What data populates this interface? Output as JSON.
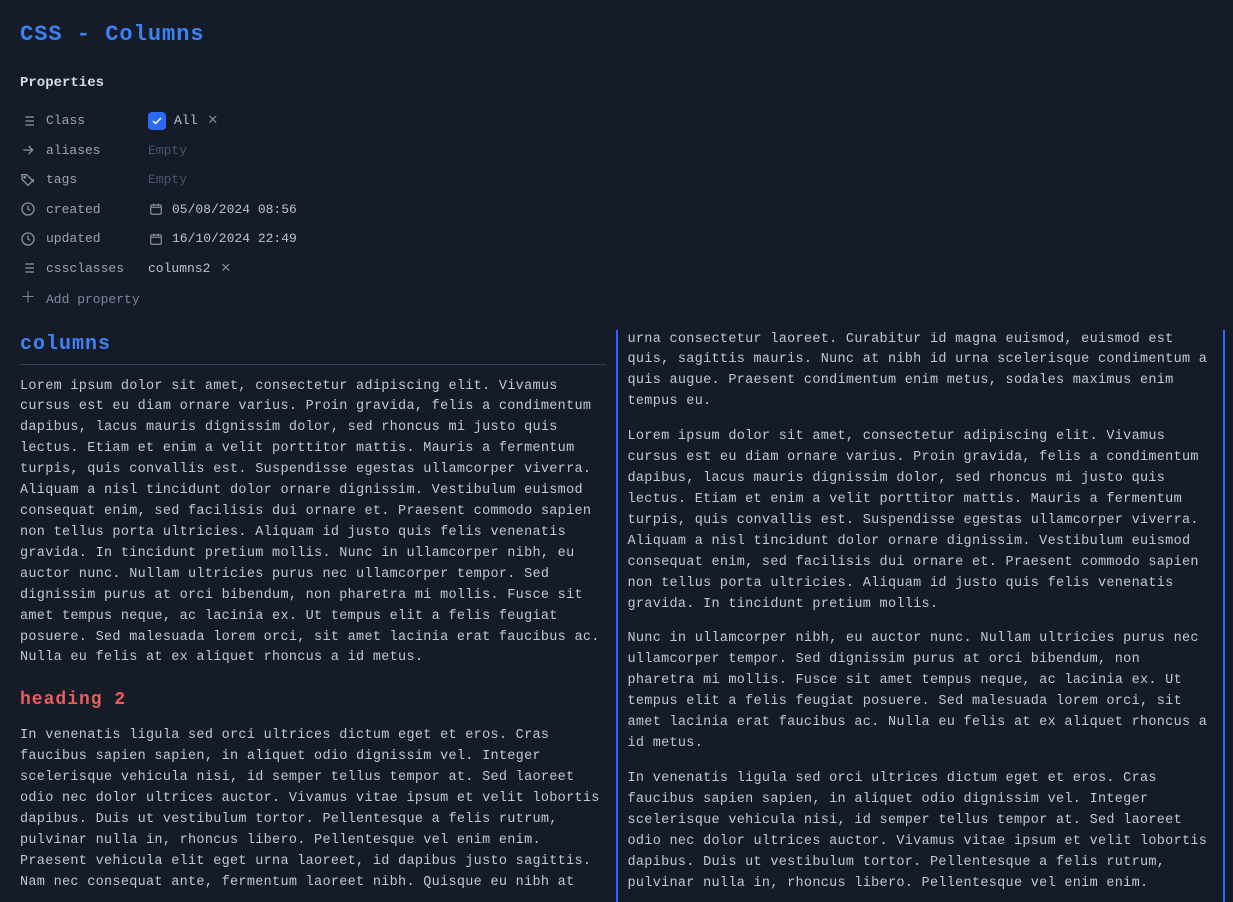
{
  "title": "CSS - Columns",
  "props": {
    "header": "Properties",
    "class_label": "Class",
    "class_value": "All",
    "aliases_label": "aliases",
    "aliases_value": "Empty",
    "tags_label": "tags",
    "tags_value": "Empty",
    "created_label": "created",
    "created_value": "05/08/2024 08:56",
    "updated_label": "updated",
    "updated_value": "16/10/2024 22:49",
    "cssclasses_label": "cssclasses",
    "cssclasses_value": "columns2",
    "add": "Add property"
  },
  "content": {
    "h1": "columns",
    "p1": "Lorem ipsum dolor sit amet, consectetur adipiscing elit. Vivamus cursus est eu diam ornare varius. Proin gravida, felis a condimentum dapibus, lacus mauris dignissim dolor, sed rhoncus mi justo quis lectus. Etiam et enim a velit porttitor mattis. Mauris a fermentum turpis, quis convallis est. Suspendisse egestas ullamcorper viverra. Aliquam a nisl tincidunt dolor ornare dignissim. Vestibulum euismod consequat enim, sed facilisis dui ornare et. Praesent commodo sapien non tellus porta ultricies. Aliquam id justo quis felis venenatis gravida. In tincidunt pretium mollis. Nunc in ullamcorper nibh, eu auctor nunc. Nullam ultricies purus nec ullamcorper tempor. Sed dignissim purus at orci bibendum, non pharetra mi mollis. Fusce sit amet tempus neque, ac lacinia ex. Ut tempus elit a felis feugiat posuere. Sed malesuada lorem orci, sit amet lacinia erat faucibus ac. Nulla eu felis at ex aliquet rhoncus a id metus.",
    "h2": "heading 2",
    "p2": "In venenatis ligula sed orci ultrices dictum eget et eros. Cras faucibus sapien sapien, in aliquet odio dignissim vel. Integer scelerisque vehicula nisi, id semper tellus tempor at. Sed laoreet odio nec dolor ultrices auctor. Vivamus vitae ipsum et velit lobortis dapibus. Duis ut vestibulum tortor. Pellentesque a felis rutrum, pulvinar nulla in, rhoncus libero. Pellentesque vel enim enim. Praesent vehicula elit eget urna laoreet, id dapibus justo sagittis. Nam nec consequat ante, fermentum laoreet nibh. Quisque eu nibh at urna consectetur laoreet. Curabitur id magna euismod, euismod est quis, sagittis mauris. Nunc at nibh id urna scelerisque condimentum a quis augue. Praesent condimentum enim metus, sodales maximus enim tempus eu.",
    "p3": "Lorem ipsum dolor sit amet, consectetur adipiscing elit. Vivamus cursus est eu diam ornare varius. Proin gravida, felis a condimentum dapibus, lacus mauris dignissim dolor, sed rhoncus mi justo quis lectus. Etiam et enim a velit porttitor mattis. Mauris a fermentum turpis, quis convallis est. Suspendisse egestas ullamcorper viverra. Aliquam a nisl tincidunt dolor ornare dignissim. Vestibulum euismod consequat enim, sed facilisis dui ornare et. Praesent commodo sapien non tellus porta ultricies. Aliquam id justo quis felis venenatis gravida. In tincidunt pretium mollis.",
    "p4": "Nunc in ullamcorper nibh, eu auctor nunc. Nullam ultricies purus nec ullamcorper tempor. Sed dignissim purus at orci bibendum, non pharetra mi mollis. Fusce sit amet tempus neque, ac lacinia ex. Ut tempus elit a felis feugiat posuere. Sed malesuada lorem orci, sit amet lacinia erat faucibus ac. Nulla eu felis at ex aliquet rhoncus a id metus.",
    "p5": "In venenatis ligula sed orci ultrices dictum eget et eros. Cras faucibus sapien sapien, in aliquet odio dignissim vel. Integer scelerisque vehicula nisi, id semper tellus tempor at. Sed laoreet odio nec dolor ultrices auctor. Vivamus vitae ipsum et velit lobortis dapibus. Duis ut vestibulum tortor. Pellentesque a felis rutrum, pulvinar nulla in, rhoncus libero. Pellentesque vel enim enim. Praesent vehicula elit eget urna laoreet, id dapibus justo sagittis. Nam nec consequat ante, fermentum laoreet nibh. Quisque eu nibh at urna consectetur laoreet. Curabitur id magna euismod, euismod est quis, sagittis mauris. Nunc at nibh id urna scelerisque condimentum a quis augue. Praesent condimentum enim metus, sodales maximus enim tempus eu."
  }
}
